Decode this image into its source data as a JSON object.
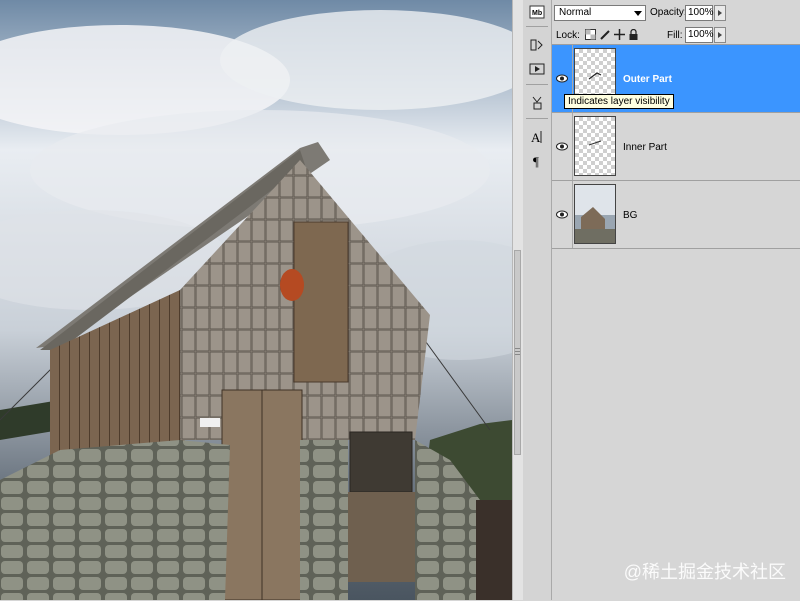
{
  "layers_panel": {
    "blend_mode": "Normal",
    "opacity_label": "Opacity:",
    "opacity_value": "100%",
    "lock_label": "Lock:",
    "fill_label": "Fill:",
    "fill_value": "100%",
    "layers": [
      {
        "name": "Outer Part",
        "selected": true,
        "visible": true
      },
      {
        "name": "Inner Part",
        "selected": false,
        "visible": true
      },
      {
        "name": "BG",
        "selected": false,
        "visible": true
      }
    ],
    "tooltip": "Indicates layer visibility"
  },
  "dock_icons": [
    "mini-bridge-icon",
    "history-icon",
    "actions-icon",
    "tool-presets-icon",
    "character-icon",
    "paragraph-icon"
  ],
  "watermark": "@稀土掘金技术社区",
  "colors": {
    "selection": "#3b95ff",
    "panel_bg": "#d6d6d6"
  }
}
